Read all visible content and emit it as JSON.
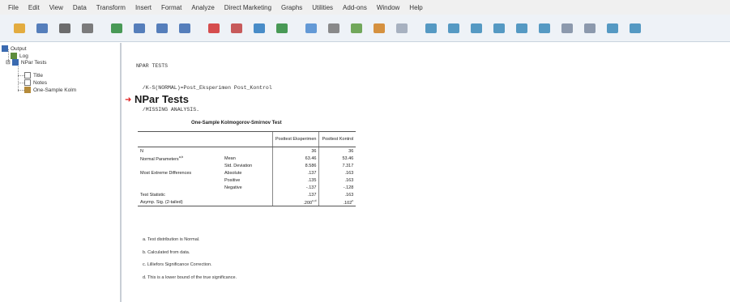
{
  "menu": [
    "File",
    "Edit",
    "View",
    "Data",
    "Transform",
    "Insert",
    "Format",
    "Analyze",
    "Direct Marketing",
    "Graphs",
    "Utilities",
    "Add-ons",
    "Window",
    "Help"
  ],
  "toolbar_icons": [
    "open-folder-icon",
    "save-icon",
    "print-icon",
    "print-preview-icon",
    "export-icon",
    "dialog-recall-icon",
    "undo-icon",
    "redo-icon",
    "goto-data-icon",
    "goto-case-icon",
    "variables-icon",
    "chart-builder-icon",
    "show-all-icon",
    "hide-icon",
    "collapse-icon",
    "expand-icon",
    "designate-window-icon",
    "insert-heading-icon",
    "insert-title-icon",
    "promote-icon",
    "demote-icon",
    "expand-node-icon",
    "collapse-node-icon",
    "show-hide-icon",
    "insert-text-icon",
    "refresh-icon",
    "last-output-icon"
  ],
  "outline": {
    "root": "Output",
    "log": "Log",
    "npar": "NPar Tests",
    "title": "Title",
    "notes": "Notes",
    "one_sample": "One-Sample Kolm"
  },
  "syntax": [
    "NPAR TESTS",
    "  /K-S(NORMAL)=Post_Eksperimen Post_Kontrol",
    "  /MISSING ANALYSIS."
  ],
  "heading": "NPar Tests",
  "table": {
    "caption": "One-Sample Kolmogorov-Smirnov Test",
    "col_headers": [
      "Posttest Eksperimen",
      "Posttest Kontrol"
    ],
    "rows": [
      {
        "label": "N",
        "sub": "",
        "v1": "36",
        "v2": "36"
      },
      {
        "label": "Normal Parameters",
        "sup": "a,b",
        "sub": "Mean",
        "v1": "63.46",
        "v2": "53.46"
      },
      {
        "label": "",
        "sub": "Std. Deviation",
        "v1": "8.586",
        "v2": "7.317"
      },
      {
        "label": "Most Extreme Differences",
        "sub": "Absolute",
        "v1": ".137",
        "v2": ".163"
      },
      {
        "label": "",
        "sub": "Positive",
        "v1": ".135",
        "v2": ".163"
      },
      {
        "label": "",
        "sub": "Negative",
        "v1": "-.137",
        "v2": "-.128"
      },
      {
        "label": "Test Statistic",
        "sub": "",
        "v1": ".137",
        "v2": ".163"
      },
      {
        "label": "Asymp. Sig. (2-tailed)",
        "sub": "",
        "v1": ".200",
        "v1sup": "c,d",
        "v2": ".102",
        "v2sup": "c"
      }
    ]
  },
  "notes": [
    "a. Test distribution is Normal.",
    "b. Calculated from data.",
    "c. Lilliefors Significance Correction.",
    "d. This is a lower bound of the true significance."
  ]
}
